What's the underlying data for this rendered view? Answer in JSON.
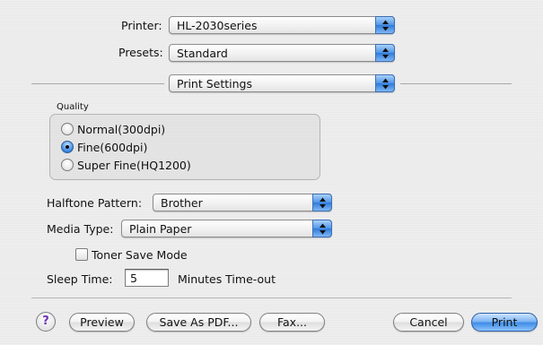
{
  "printer": {
    "label": "Printer:",
    "value": "HL-2030series"
  },
  "presets": {
    "label": "Presets:",
    "value": "Standard"
  },
  "panel": {
    "value": "Print Settings"
  },
  "quality": {
    "title": "Quality",
    "options": [
      {
        "label": "Normal(300dpi)",
        "selected": false
      },
      {
        "label": "Fine(600dpi)",
        "selected": true
      },
      {
        "label": "Super Fine(HQ1200)",
        "selected": false
      }
    ]
  },
  "halftone": {
    "label": "Halftone Pattern:",
    "value": "Brother"
  },
  "media": {
    "label": "Media Type:",
    "value": "Plain Paper"
  },
  "toner": {
    "label": "Toner Save Mode",
    "checked": false
  },
  "sleep": {
    "label": "Sleep Time:",
    "value": "5",
    "suffix": "Minutes Time-out"
  },
  "buttons": {
    "help": "?",
    "preview": "Preview",
    "save_pdf": "Save As PDF...",
    "fax": "Fax...",
    "cancel": "Cancel",
    "print": "Print"
  },
  "colors": {
    "accent": "#3f8de8",
    "help_glyph": "#6a2fb8"
  }
}
